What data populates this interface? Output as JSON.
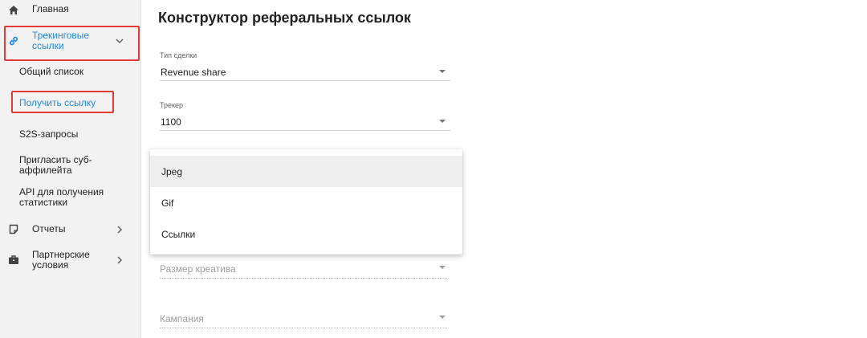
{
  "sidebar": {
    "home": {
      "label": "Главная",
      "icon": "home-icon"
    },
    "tracking": {
      "label": "Трекинговые ссылки",
      "icon": "link-icon",
      "expanded": true
    },
    "sub_items": [
      {
        "label": "Общий список"
      },
      {
        "label": "Получить ссылку",
        "active": true
      },
      {
        "label": "S2S-запросы"
      },
      {
        "label": "Пригласить суб-аффилейта"
      },
      {
        "label": "API для получения статистики"
      }
    ],
    "reports": {
      "label": "Отчеты",
      "icon": "report-icon"
    },
    "partner": {
      "label": "Партнерские условия",
      "icon": "briefcase-icon"
    }
  },
  "main": {
    "title": "Конструктор реферальных ссылок",
    "deal_type": {
      "label": "Тип сделки",
      "value": "Revenue share"
    },
    "tracker": {
      "label": "Трекер",
      "value": "1100"
    },
    "menu_options": [
      {
        "label": "Jpeg",
        "highlighted": true
      },
      {
        "label": "Gif"
      },
      {
        "label": "Ссылки"
      }
    ],
    "creative_size": {
      "placeholder": "Размер креатива"
    },
    "campaign": {
      "placeholder": "Кампания"
    }
  },
  "colors": {
    "highlight_box": "#e53935",
    "accent_link": "#1e88e5",
    "sidebar_bg": "#f2f2f2"
  }
}
